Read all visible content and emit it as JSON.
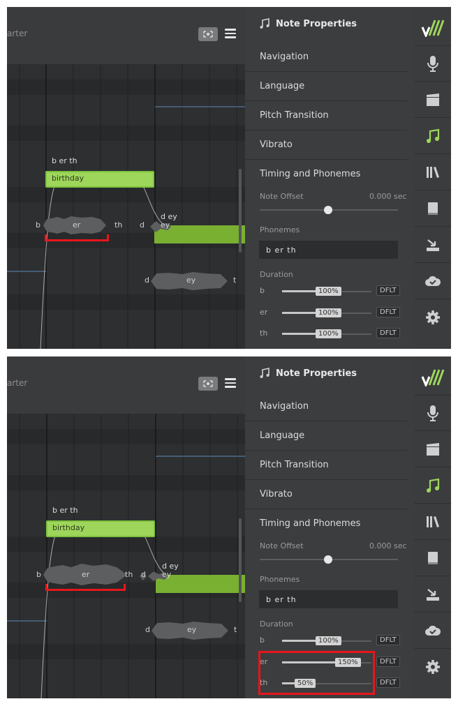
{
  "toolbar": {
    "quantize_label": "arter"
  },
  "panel": {
    "title": "Note Properties",
    "sections": [
      "Navigation",
      "Language",
      "Pitch Transition",
      "Vibrato",
      "Timing and Phonemes"
    ],
    "note_offset_label": "Note Offset",
    "note_offset_value": "0.000 sec",
    "phonemes_label": "Phonemes",
    "phonemes_value": "b er th",
    "duration_label": "Duration",
    "default_label": "DFLT"
  },
  "shots": [
    {
      "note1": {
        "phonemes_label": "b er th",
        "lyric": "birthday"
      },
      "note2": {
        "phonemes_label": "d ey"
      },
      "phonemes": [
        "b",
        "er",
        "th",
        "d",
        "ey"
      ],
      "lower": [
        "d",
        "ey",
        "t"
      ],
      "durations": [
        {
          "phoneme": "b",
          "percent_label": "100%",
          "fraction": 0.5
        },
        {
          "phoneme": "er",
          "percent_label": "100%",
          "fraction": 0.5
        },
        {
          "phoneme": "th",
          "percent_label": "100%",
          "fraction": 0.5
        }
      ]
    },
    {
      "note1": {
        "phonemes_label": "b er th",
        "lyric": "birthday"
      },
      "note2": {
        "phonemes_label": "d ey"
      },
      "phonemes": [
        "b",
        "er",
        "th",
        "d",
        "ey"
      ],
      "lower": [
        "d",
        "ey",
        "t"
      ],
      "durations": [
        {
          "phoneme": "b",
          "percent_label": "100%",
          "fraction": 0.5
        },
        {
          "phoneme": "er",
          "percent_label": "150%",
          "fraction": 0.75
        },
        {
          "phoneme": "th",
          "percent_label": "50%",
          "fraction": 0.25
        }
      ]
    }
  ],
  "colors": {
    "accent_green": "#9ed65c",
    "highlight_red": "#e8161a"
  },
  "icons": [
    "logo-icon",
    "microphone-icon",
    "clapperboard-icon",
    "music-note-icon",
    "library-icon",
    "book-icon",
    "render-icon",
    "cloud-icon",
    "gear-icon"
  ]
}
